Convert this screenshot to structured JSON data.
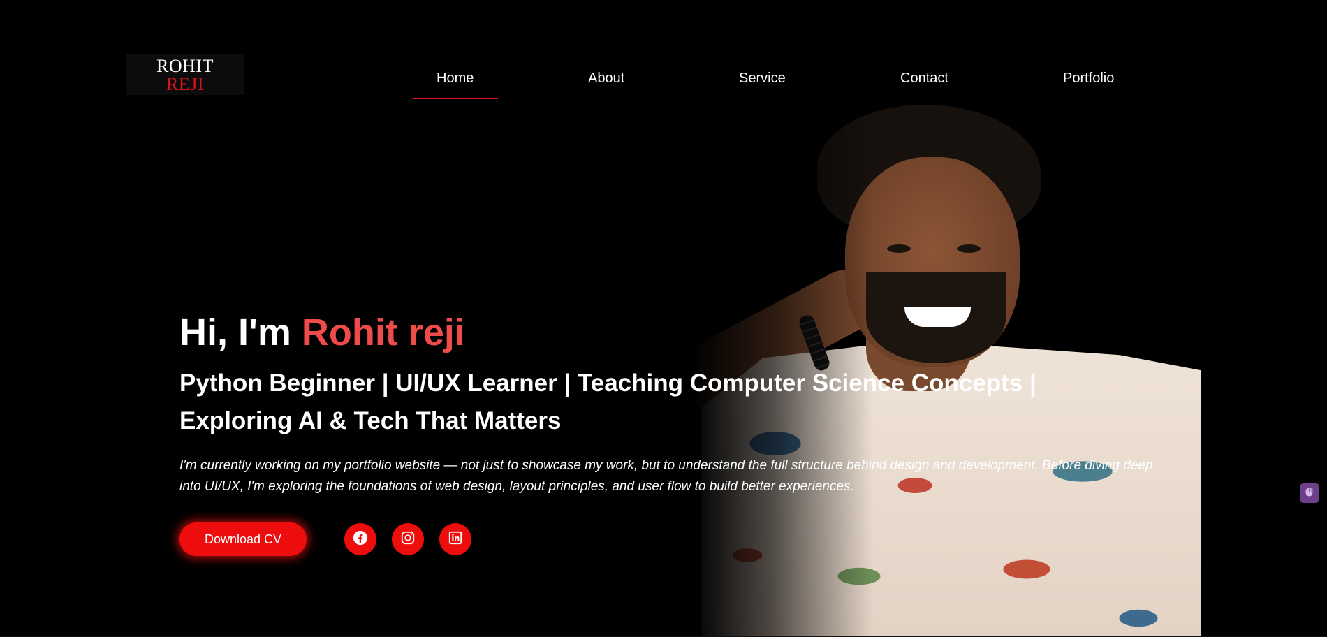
{
  "logo": {
    "line1": "ROHIT",
    "line2": "REJI"
  },
  "nav": {
    "items": [
      {
        "label": "Home",
        "active": true
      },
      {
        "label": "About"
      },
      {
        "label": "Service"
      },
      {
        "label": "Contact"
      },
      {
        "label": "Portfolio"
      }
    ]
  },
  "hero": {
    "greeting_prefix": "Hi, I'm",
    "name": "Rohit reji",
    "subtitle": "Python Beginner | UI/UX Learner | Teaching Computer Science Concepts | Exploring AI & Tech That Matters",
    "description": "I'm currently working on my portfolio website — not just to showcase my work, but to understand the full structure behind design and development. Before diving deep into UI/UX, I'm exploring the foundations of web design, layout principles, and user flow to build better experiences.",
    "cv_button": "Download CV",
    "social_icons": [
      "facebook-icon",
      "instagram-icon",
      "linkedin-icon"
    ]
  },
  "colors": {
    "accent": "#ee0d0d",
    "name_accent": "#ef4b4b",
    "background": "#000000",
    "widget": "#6c3f88"
  }
}
